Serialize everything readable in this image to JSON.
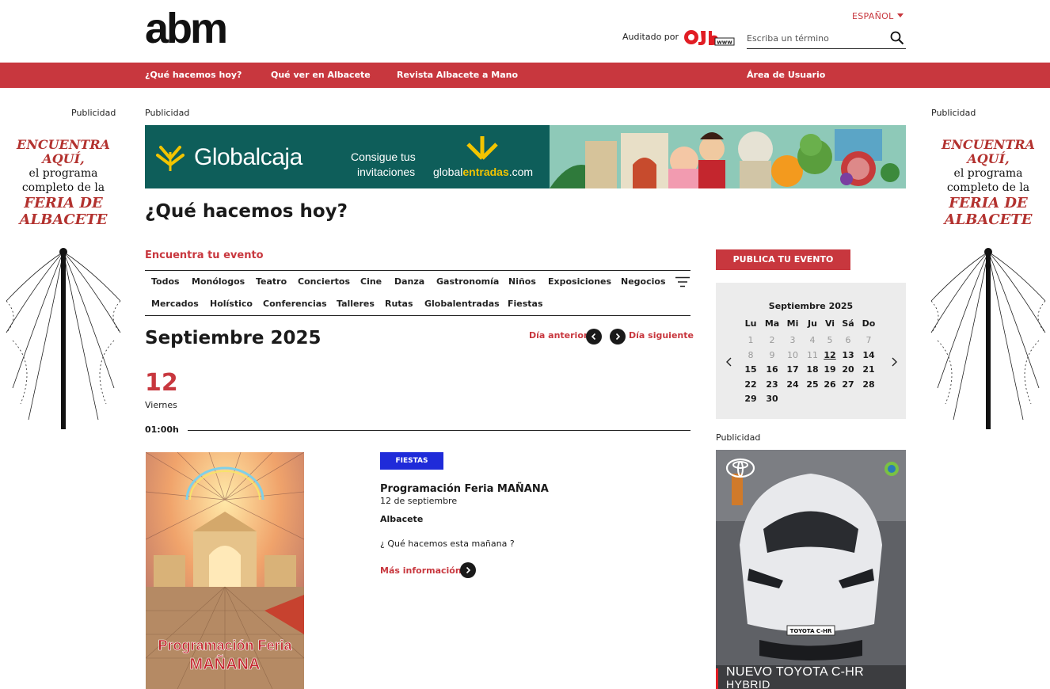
{
  "header": {
    "logo": "abm",
    "language": "ESPAÑOL",
    "audited_by": "Auditado por",
    "audited_logo": "ojd www",
    "search_placeholder": "Escriba un término"
  },
  "nav": {
    "items": [
      "¿Qué hacemos hoy?",
      "Qué ver en Albacete",
      "Revista Albacete a Mano"
    ],
    "user_area": "Área de Usuario"
  },
  "ads": {
    "label": "Publicidad",
    "side_banner": {
      "line1": "ENCUENTRA",
      "line2": "AQUÍ,",
      "line3": "el programa",
      "line4": "completo de la",
      "line5": "FERIA DE",
      "line6": "ALBACETE"
    },
    "top_banner": {
      "brand": "Globalcaja",
      "cta_line1": "Consigue tus",
      "cta_line2": "invitaciones",
      "site_pre": "global",
      "site_bold": "entradas",
      "site_post": ".com"
    },
    "toyota": {
      "line1": "NUEVO TOYOTA C-HR",
      "line2": "HYBRID",
      "plate": "TOYOTA C-HR"
    }
  },
  "page": {
    "title": "¿Qué hacemos hoy?",
    "find_event": "Encuentra tu evento",
    "categories_row1": [
      "Todos",
      "Monólogos",
      "Teatro",
      "Conciertos",
      "Cine",
      "Danza",
      "Gastronomía",
      "Niños",
      "Exposiciones",
      "Negocios"
    ],
    "categories_row2": [
      "Mercados",
      "Holístico",
      "Conferencias",
      "Talleres",
      "Rutas",
      "Globalentradas",
      "Fiestas"
    ],
    "month_title": "Septiembre 2025",
    "prev_day": "Día anterior",
    "next_day": "Día siguiente",
    "day_number": "12",
    "day_name": "Viernes",
    "time": "01:00h"
  },
  "event": {
    "tag": "FIESTAS",
    "title": "Programación Feria MAÑANA",
    "date": "12 de septiembre",
    "place": "Albacete",
    "description": "¿ Qué hacemos esta mañana ?",
    "more": "Más información",
    "poster_line1": "Programación Feria",
    "poster_line2": "MAÑANA"
  },
  "sidebar": {
    "publish_button": "PUBLICA TU EVENTO",
    "calendar": {
      "title": "Septiembre 2025",
      "weekdays": [
        "Lu",
        "Ma",
        "Mi",
        "Ju",
        "Vi",
        "Sá",
        "Do"
      ],
      "weeks": [
        [
          "1",
          "2",
          "3",
          "4",
          "5",
          "6",
          "7"
        ],
        [
          "8",
          "9",
          "10",
          "11",
          "12",
          "13",
          "14"
        ],
        [
          "15",
          "16",
          "17",
          "18",
          "19",
          "20",
          "21"
        ],
        [
          "22",
          "23",
          "24",
          "25",
          "26",
          "27",
          "28"
        ],
        [
          "29",
          "30",
          "",
          "",
          "",
          "",
          ""
        ]
      ],
      "selected_day": "12"
    }
  },
  "colors": {
    "brand_red": "#c8373e",
    "tag_blue": "#1f2bd9",
    "banner_teal": "#0e5e5a"
  }
}
